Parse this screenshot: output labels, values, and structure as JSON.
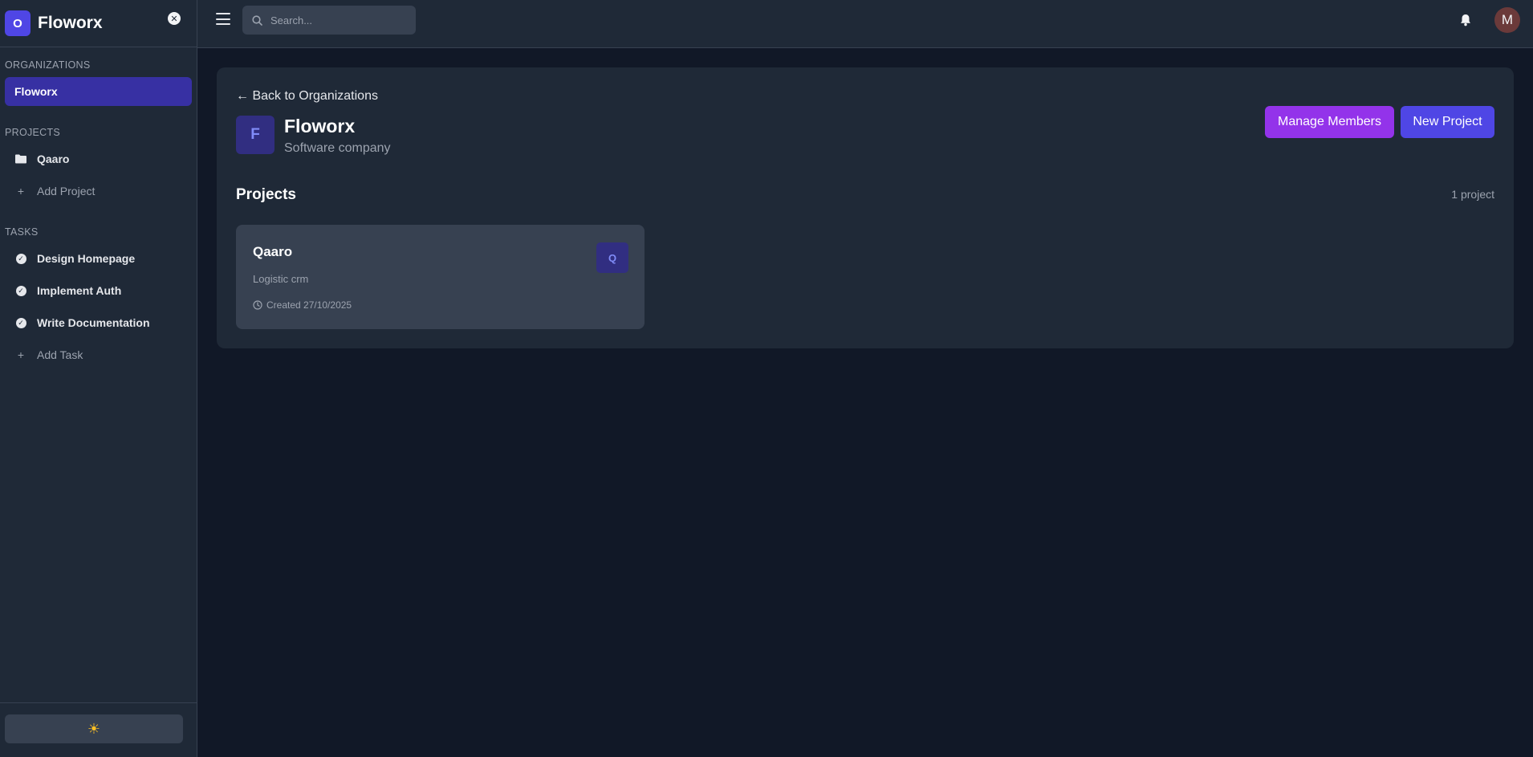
{
  "sidebar": {
    "brand_initial": "O",
    "brand_name": "Floworx",
    "organizations_title": "Organizations",
    "organizations": [
      {
        "label": "Floworx"
      }
    ],
    "projects_title": "Projects",
    "projects": [
      {
        "label": "Qaaro",
        "icon": "folder-icon"
      }
    ],
    "add_project_label": "Add Project",
    "tasks_title": "Tasks",
    "tasks": [
      {
        "label": "Design Homepage",
        "icon": "check-circle-icon"
      },
      {
        "label": "Implement Auth",
        "icon": "check-circle-icon"
      },
      {
        "label": "Write Documentation",
        "icon": "check-circle-icon"
      }
    ],
    "add_task_label": "Add Task",
    "theme_icon": "sun-icon"
  },
  "topbar": {
    "search_placeholder": "Search...",
    "avatar_initial": "M"
  },
  "main": {
    "back_label": "← Back to Organizations",
    "org_initial": "F",
    "org_name": "Floworx",
    "org_description": "Software company",
    "manage_members_label": "Manage Members",
    "new_project_label": "New Project",
    "projects_heading": "Projects",
    "projects_count": "1 project",
    "projects": [
      {
        "name": "Qaaro",
        "description": "Logistic crm",
        "created": "Created 27/10/2025",
        "badge": "Q"
      }
    ]
  },
  "colors": {
    "background": "#111827",
    "surface": "#1f2937",
    "accent": "#4f46e5",
    "manage_button": "#9333ea"
  }
}
